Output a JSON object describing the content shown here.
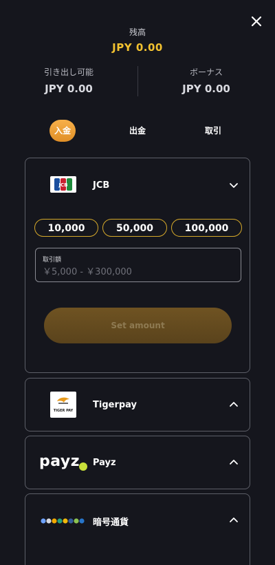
{
  "close_icon": "close-icon",
  "balance": {
    "label": "残高",
    "value": "JPY 0.00",
    "color": "#f2c230"
  },
  "withdrawable": {
    "label": "引き出し可能",
    "value": "JPY 0.00"
  },
  "bonus": {
    "label": "ボーナス",
    "value": "JPY 0.00"
  },
  "tabs": [
    {
      "label": "入金",
      "active": true
    },
    {
      "label": "出金",
      "active": false
    },
    {
      "label": "取引",
      "active": false
    }
  ],
  "methods": {
    "jcb": {
      "name": "JCB",
      "logo_text": "JCB",
      "expanded": true,
      "chevron": "chevron-down-icon",
      "quick_amounts": [
        "10,000",
        "50,000",
        "100,000"
      ],
      "amount_field_label": "取引額",
      "amount_placeholder": "￥5,000 - ￥300,000",
      "amount_value": "",
      "set_button_label": "Set amount"
    },
    "tigerpay": {
      "name": "Tigerpay",
      "logo_text": "TIGER PAY",
      "chevron": "chevron-up-icon"
    },
    "payz": {
      "name": "Payz",
      "logo_text": "payz",
      "chevron": "chevron-up-icon"
    },
    "crypto": {
      "name": "暗号通貨",
      "chevron": "chevron-up-icon"
    }
  },
  "accent_color": "#e9a03a"
}
